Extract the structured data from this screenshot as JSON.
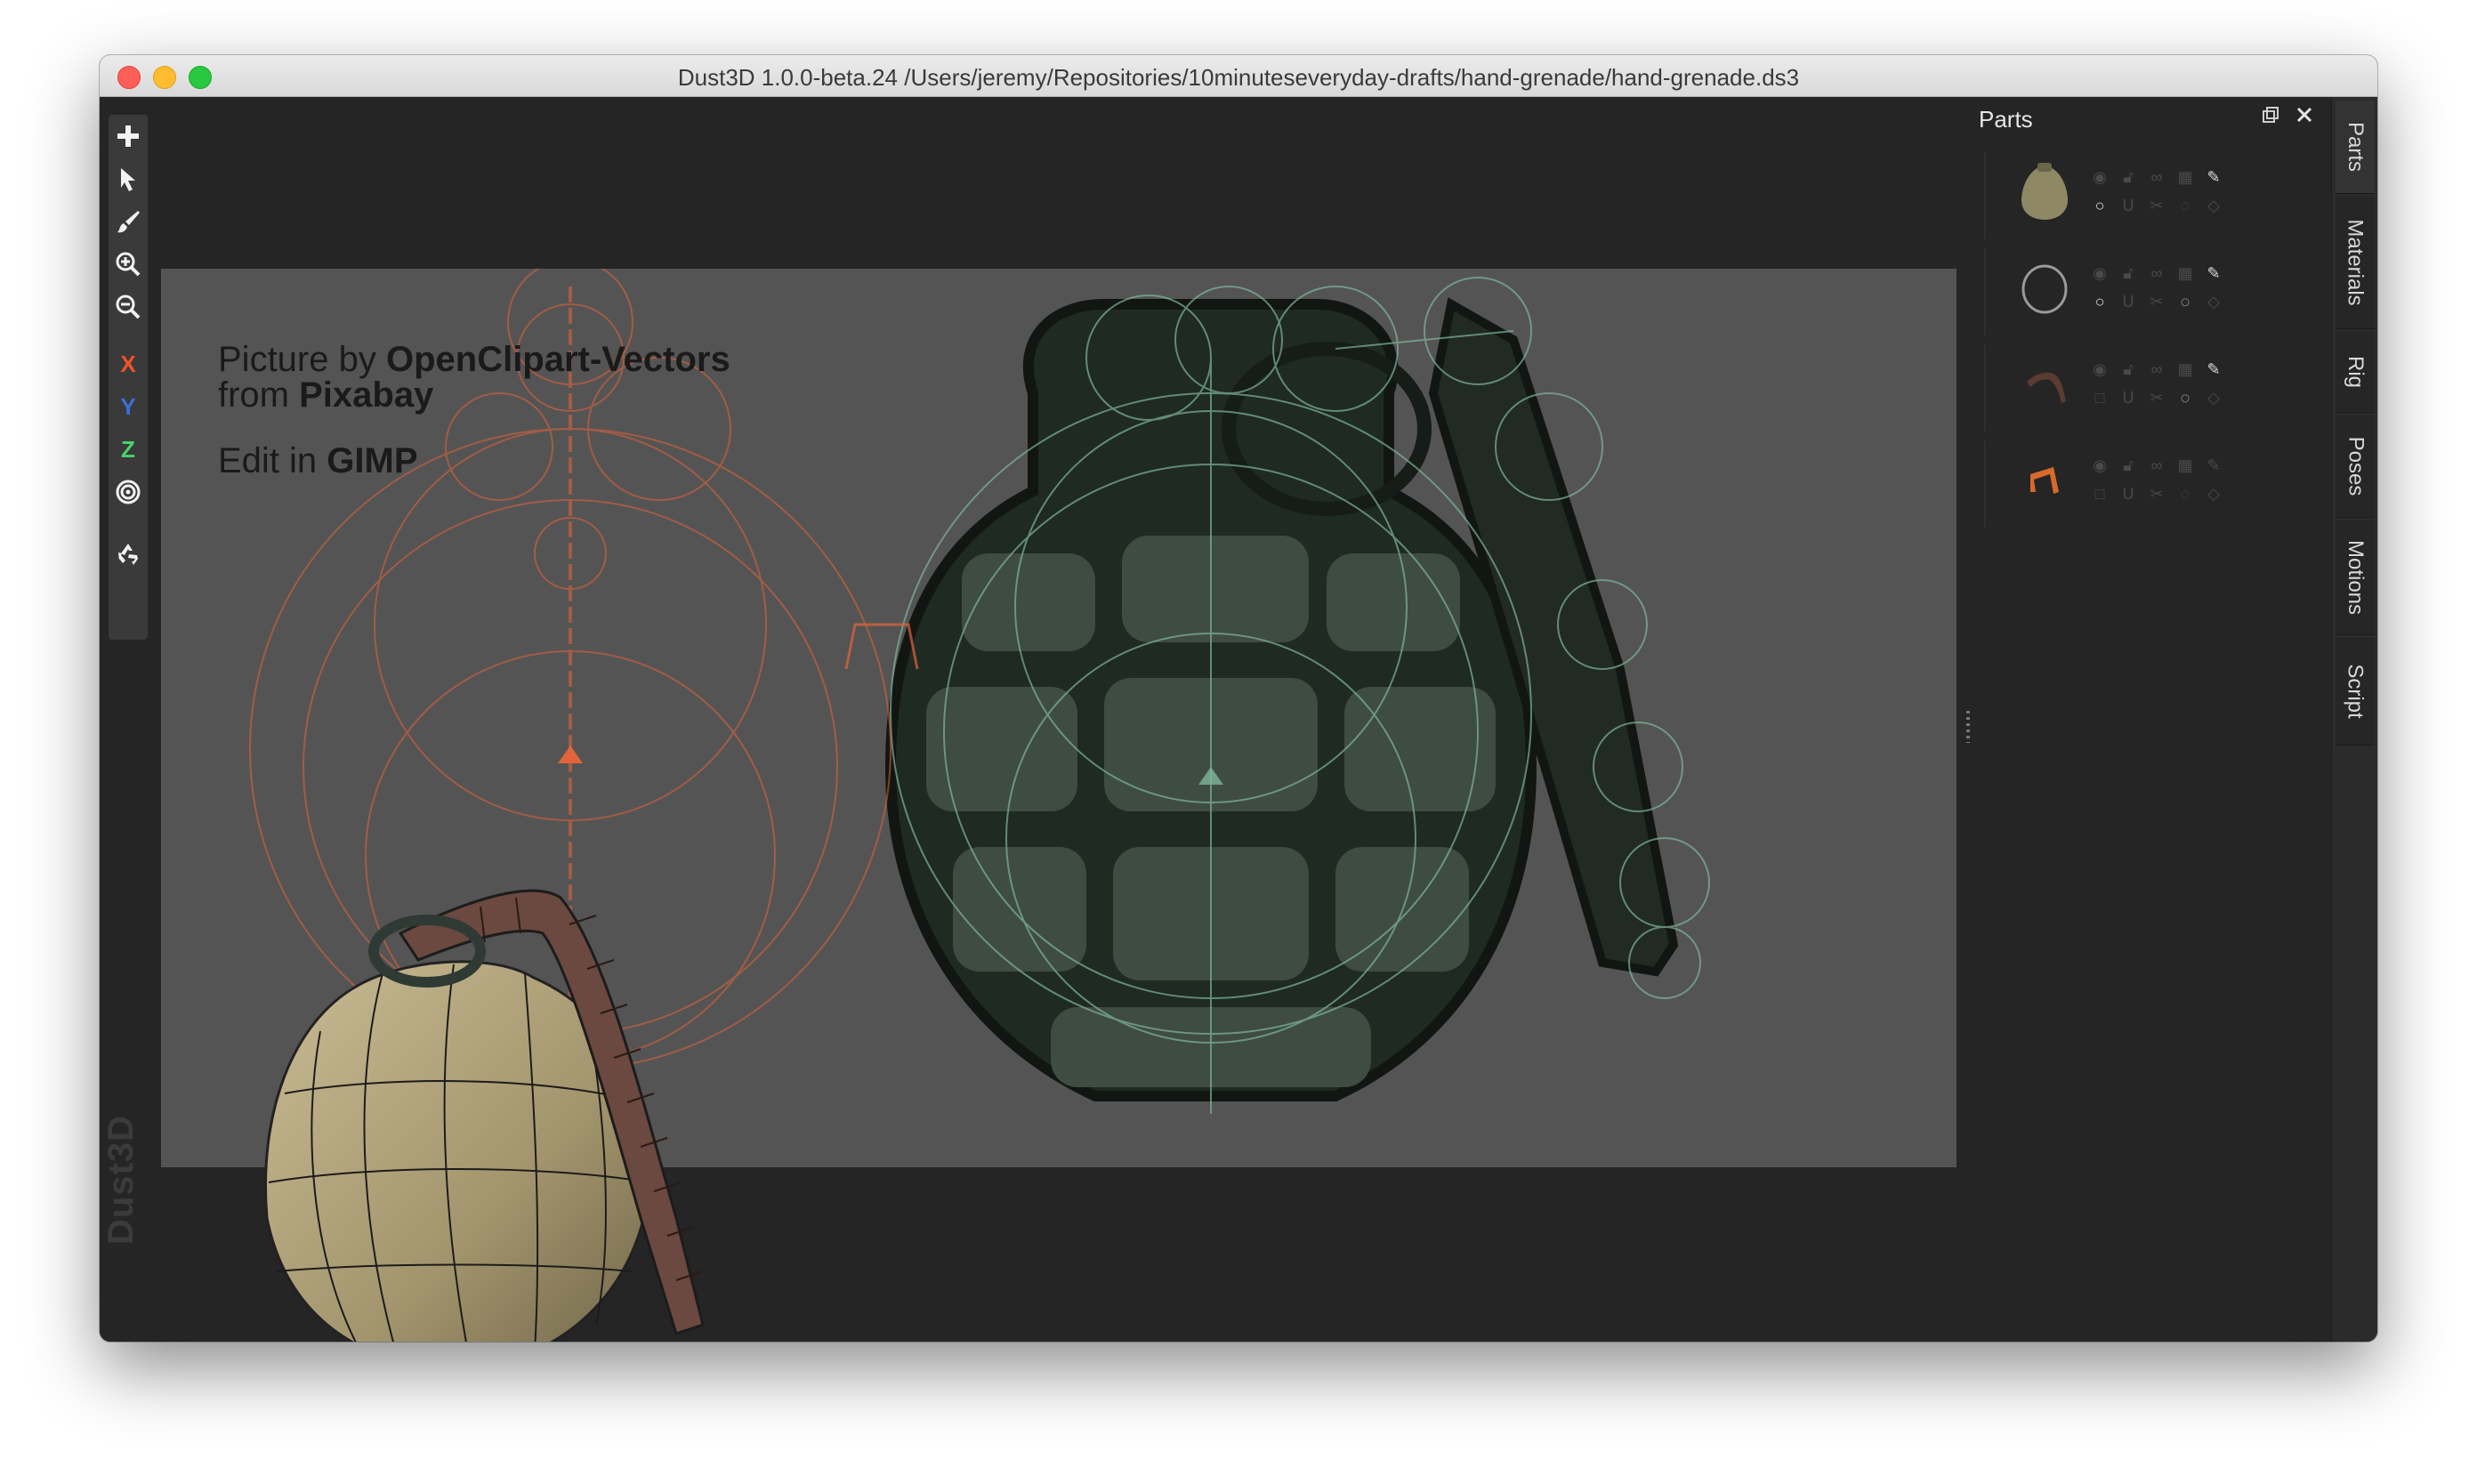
{
  "window": {
    "title": "Dust3D 1.0.0-beta.24 /Users/jeremy/Repositories/10minuteseveryday-drafts/hand-grenade/hand-grenade.ds3"
  },
  "toolbar": {
    "tools": [
      "add-icon",
      "select-icon",
      "paint-brush-icon",
      "zoom-in-icon",
      "zoom-out-icon"
    ],
    "axis_x": "X",
    "axis_y": "Y",
    "axis_z": "Z",
    "extra_tools": [
      "radial-target-icon",
      "recycle-icon"
    ]
  },
  "brand": "Dust3D",
  "reference_credit": {
    "line1_prefix": "Picture by ",
    "line1_name": "OpenClipart-Vectors",
    "line2_prefix": "from ",
    "line2_name": "Pixabay",
    "line3_prefix": "Edit in ",
    "line3_name": "GIMP"
  },
  "parts_panel": {
    "title": "Parts",
    "float_icon": "float-window-icon",
    "close_icon": "close-icon",
    "parts": [
      {
        "thumbnail": "grenade-body",
        "thumb_color": "#8f8864"
      },
      {
        "thumbnail": "ring",
        "thumb_color": "#9a9a9a"
      },
      {
        "thumbnail": "lever-dark",
        "thumb_color": "#5a3c30"
      },
      {
        "thumbnail": "pin-orange",
        "thumb_color": "#d66a2a"
      }
    ]
  },
  "side_tabs": [
    "Parts",
    "Materials",
    "Rig",
    "Poses",
    "Motions",
    "Script"
  ],
  "colors": {
    "accent_orange": "#e2643a",
    "guide_green": "#7fb59a",
    "reference_bg": "#545454",
    "workspace_bg": "#252525"
  }
}
